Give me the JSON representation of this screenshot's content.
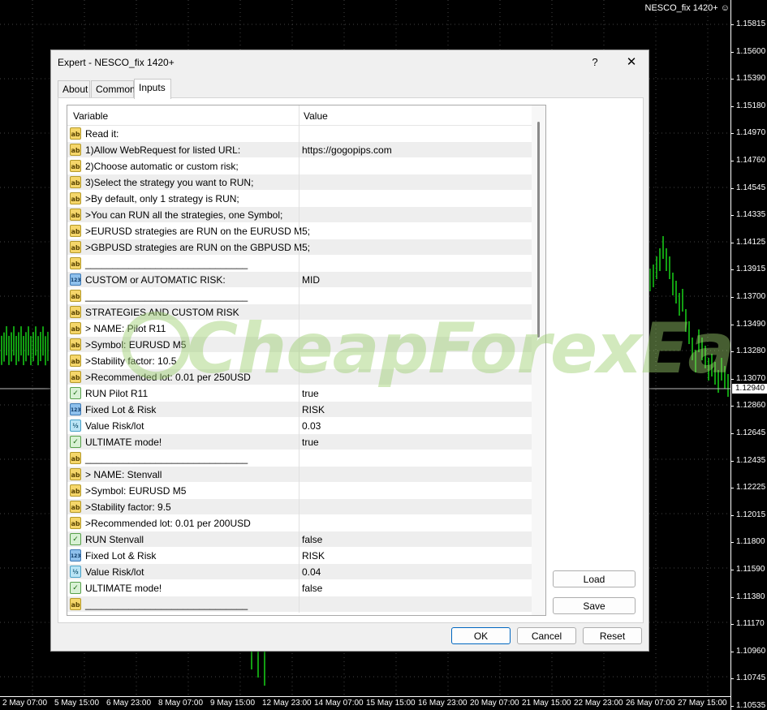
{
  "chart": {
    "title": "NESCO_fix 1420+",
    "current_price": "1.12940",
    "price_labels": [
      "1.15815",
      "1.15600",
      "1.15390",
      "1.15180",
      "1.14970",
      "1.14760",
      "1.14545",
      "1.14335",
      "1.14125",
      "1.13915",
      "1.13700",
      "1.13490",
      "1.13280",
      "1.13070",
      "1.12860",
      "1.12645",
      "1.12435",
      "1.12225",
      "1.12015",
      "1.11800",
      "1.11590",
      "1.11380",
      "1.11170",
      "1.10960",
      "1.10745",
      "1.10535"
    ],
    "time_labels": [
      "2 May 07:00",
      "5 May 15:00",
      "6 May 23:00",
      "8 May 07:00",
      "9 May 15:00",
      "12 May 23:00",
      "14 May 07:00",
      "15 May 15:00",
      "16 May 23:00",
      "20 May 07:00",
      "21 May 15:00",
      "22 May 23:00",
      "26 May 07:00",
      "27 May 15:00"
    ]
  },
  "dialog": {
    "title": "Expert - NESCO_fix 1420+",
    "help": "?",
    "close": "✕",
    "tabs": [
      {
        "label": "About"
      },
      {
        "label": "Common"
      },
      {
        "label": "Inputs",
        "active": true
      }
    ],
    "grid": {
      "col_variable": "Variable",
      "col_value": "Value",
      "rows": [
        {
          "icon": "ab",
          "variable": "Read it:",
          "value": ""
        },
        {
          "icon": "ab",
          "variable": "1)Allow WebRequest for listed URL:",
          "value": "https://gogopips.com"
        },
        {
          "icon": "ab",
          "variable": "2)Choose automatic or custom risk;",
          "value": ""
        },
        {
          "icon": "ab",
          "variable": "3)Select the strategy you want to RUN;",
          "value": ""
        },
        {
          "icon": "ab",
          "variable": ">By default, only 1 strategy is RUN;",
          "value": ""
        },
        {
          "icon": "ab",
          "variable": ">You can RUN all the strategies, one Symbol;",
          "value": ""
        },
        {
          "icon": "ab",
          "variable": ">EURUSD strategies are RUN on the EURUSD M5;",
          "value": ""
        },
        {
          "icon": "ab",
          "variable": ">GBPUSD strategies are RUN on the GBPUSD M5;",
          "value": ""
        },
        {
          "icon": "ab",
          "variable": "______________________________",
          "value": ""
        },
        {
          "icon": "123",
          "variable": "CUSTOM or AUTOMATIC RISK:",
          "value": "MID"
        },
        {
          "icon": "ab",
          "variable": "______________________________",
          "value": ""
        },
        {
          "icon": "ab",
          "variable": "STRATEGIES AND CUSTOM RISK",
          "value": ""
        },
        {
          "icon": "ab",
          "variable": "> NAME: Pilot R11",
          "value": ""
        },
        {
          "icon": "ab",
          "variable": ">Symbol: EURUSD M5",
          "value": ""
        },
        {
          "icon": "ab",
          "variable": ">Stability factor: 10.5",
          "value": ""
        },
        {
          "icon": "ab",
          "variable": ">Recommended lot: 0.01 per 250USD",
          "value": ""
        },
        {
          "icon": "bool",
          "variable": "RUN Pilot R11",
          "value": "true"
        },
        {
          "icon": "123",
          "variable": "Fixed Lot & Risk",
          "value": "RISK"
        },
        {
          "icon": "dbl",
          "variable": "Value Risk/lot",
          "value": "0.03"
        },
        {
          "icon": "bool",
          "variable": "ULTIMATE mode!",
          "value": "true"
        },
        {
          "icon": "ab",
          "variable": "______________________________",
          "value": ""
        },
        {
          "icon": "ab",
          "variable": "> NAME: Stenvall",
          "value": ""
        },
        {
          "icon": "ab",
          "variable": ">Symbol: EURUSD M5",
          "value": ""
        },
        {
          "icon": "ab",
          "variable": ">Stability factor: 9.5",
          "value": ""
        },
        {
          "icon": "ab",
          "variable": ">Recommended lot: 0.01 per 200USD",
          "value": ""
        },
        {
          "icon": "bool",
          "variable": "RUN Stenvall",
          "value": "false"
        },
        {
          "icon": "123",
          "variable": "Fixed Lot & Risk",
          "value": "RISK"
        },
        {
          "icon": "dbl",
          "variable": "Value Risk/lot",
          "value": "0.04"
        },
        {
          "icon": "bool",
          "variable": "ULTIMATE mode!",
          "value": "false"
        },
        {
          "icon": "ab",
          "variable": "______________________________",
          "value": ""
        }
      ]
    },
    "buttons": {
      "load": "Load",
      "save": "Save",
      "ok": "OK",
      "cancel": "Cancel",
      "reset": "Reset"
    },
    "icon_glyphs": {
      "ab": "ab",
      "123": "123",
      "dbl": "½",
      "bool": "✓"
    }
  },
  "watermark": {
    "text": "CheapForexEa"
  }
}
